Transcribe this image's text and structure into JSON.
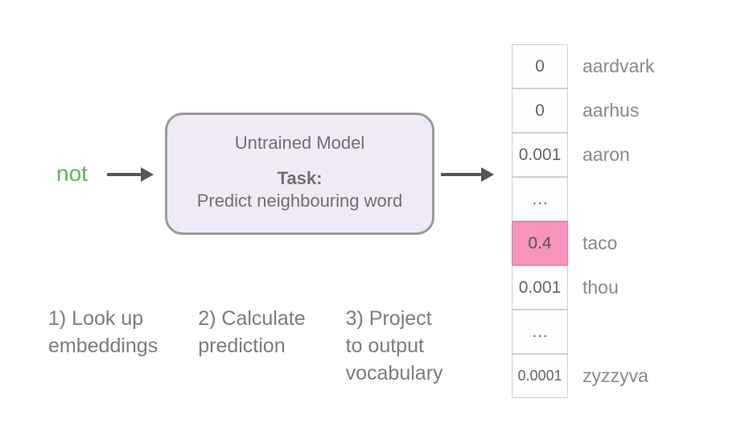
{
  "input_word": "not",
  "model": {
    "title": "Untrained Model",
    "task_label": "Task:",
    "task_desc": "Predict neighbouring word"
  },
  "steps": {
    "s1_l1": "1) Look up",
    "s1_l2": "embeddings",
    "s2_l1": "2) Calculate",
    "s2_l2": "prediction",
    "s3_l1": "3) Project",
    "s3_l2": "to output",
    "s3_l3": "vocabulary"
  },
  "output": [
    {
      "value": "0",
      "word": "aardvark",
      "highlight": false
    },
    {
      "value": "0",
      "word": "aarhus",
      "highlight": false
    },
    {
      "value": "0.001",
      "word": "aaron",
      "highlight": false
    },
    {
      "value": "…",
      "word": "",
      "highlight": false
    },
    {
      "value": "0.4",
      "word": "taco",
      "highlight": true
    },
    {
      "value": "0.001",
      "word": "thou",
      "highlight": false
    },
    {
      "value": "…",
      "word": "",
      "highlight": false
    },
    {
      "value": "0.0001",
      "word": "zyzzyva",
      "highlight": false
    }
  ]
}
